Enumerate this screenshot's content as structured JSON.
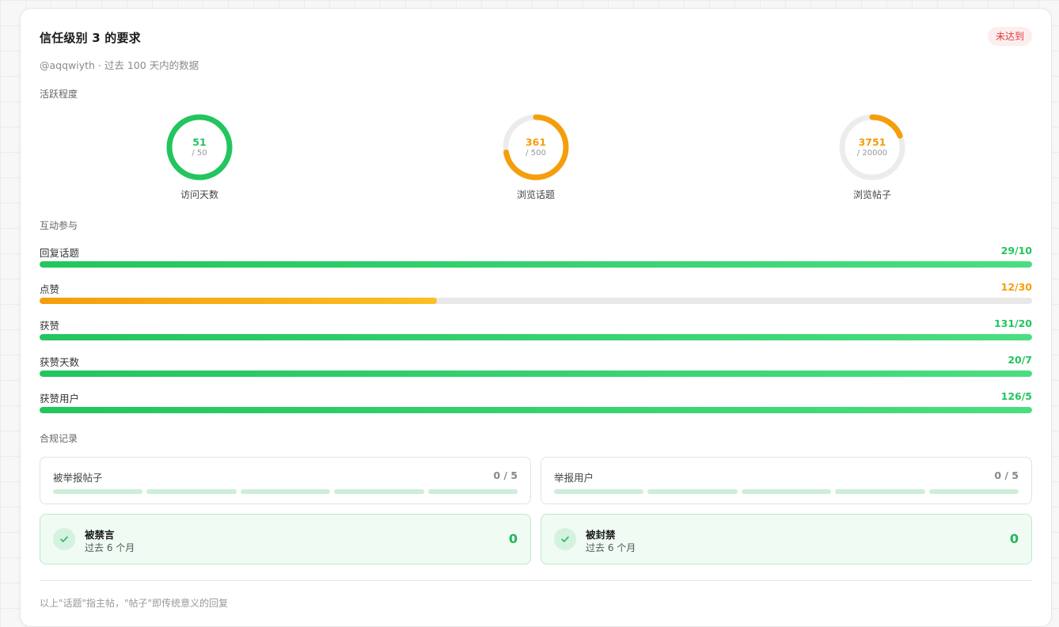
{
  "header": {
    "title": "信任级别 3 的要求",
    "status_badge": "未达到",
    "subtitle": "@aqqwiyth · 过去 100 天内的数据"
  },
  "sections": {
    "activity": "活跃程度",
    "interaction": "互动参与",
    "compliance": "合规记录"
  },
  "activity_rings": [
    {
      "value": "51",
      "target": "/ 50",
      "label": "访问天数",
      "fraction": 1.0,
      "color": "#22c55e"
    },
    {
      "value": "361",
      "target": "/ 500",
      "label": "浏览话题",
      "fraction": 0.722,
      "color": "#f59e0b"
    },
    {
      "value": "3751",
      "target": "/ 20000",
      "label": "浏览帖子",
      "fraction": 0.1876,
      "color": "#f59e0b"
    }
  ],
  "interaction_bars": [
    {
      "label": "回复话题",
      "value": "29/10",
      "fraction": 1.0,
      "status": "met"
    },
    {
      "label": "点赞",
      "value": "12/30",
      "fraction": 0.4,
      "status": "unmet"
    },
    {
      "label": "获赞",
      "value": "131/20",
      "fraction": 1.0,
      "status": "met"
    },
    {
      "label": "获赞天数",
      "value": "20/7",
      "fraction": 1.0,
      "status": "met"
    },
    {
      "label": "获赞用户",
      "value": "126/5",
      "fraction": 1.0,
      "status": "met"
    }
  ],
  "compliance_boxes": [
    {
      "label": "被举报帖子",
      "count": "0 / 5",
      "segments": 5,
      "filled": 0
    },
    {
      "label": "举报用户",
      "count": "0 / 5",
      "segments": 5,
      "filled": 0
    }
  ],
  "status_boxes": [
    {
      "title": "被禁言",
      "subtitle": "过去 6 个月",
      "value": "0",
      "icon": "check-icon"
    },
    {
      "title": "被封禁",
      "subtitle": "过去 6 个月",
      "value": "0",
      "icon": "check-icon"
    }
  ],
  "footnote": "以上\"话题\"指主帖，\"帖子\"即传统意义的回复",
  "colors": {
    "met": "#22c55e",
    "unmet": "#f59e0b",
    "danger": "#e03a3a"
  }
}
